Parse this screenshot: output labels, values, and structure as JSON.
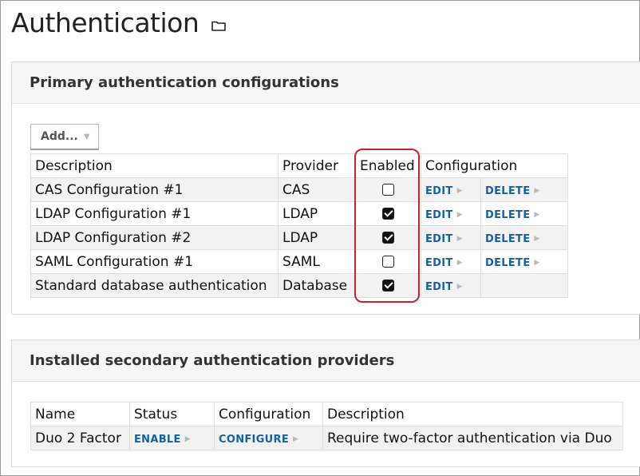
{
  "page": {
    "title": "Authentication",
    "title_icon": "folder-icon"
  },
  "primary": {
    "heading": "Primary authentication configurations",
    "add_label": "Add...",
    "columns": [
      "Description",
      "Provider",
      "Enabled",
      "Configuration"
    ],
    "rows": [
      {
        "description": "CAS Configuration #1",
        "provider": "CAS",
        "enabled": false,
        "edit": "EDIT",
        "delete": "DELETE"
      },
      {
        "description": "LDAP Configuration #1",
        "provider": "LDAP",
        "enabled": true,
        "edit": "EDIT",
        "delete": "DELETE"
      },
      {
        "description": "LDAP Configuration #2",
        "provider": "LDAP",
        "enabled": true,
        "edit": "EDIT",
        "delete": "DELETE"
      },
      {
        "description": "SAML Configuration #1",
        "provider": "SAML",
        "enabled": false,
        "edit": "EDIT",
        "delete": "DELETE"
      },
      {
        "description": "Standard database authentication",
        "provider": "Database",
        "enabled": true,
        "edit": "EDIT",
        "delete": ""
      }
    ]
  },
  "secondary": {
    "heading": "Installed secondary authentication providers",
    "columns": [
      "Name",
      "Status",
      "Configuration",
      "Description"
    ],
    "rows": [
      {
        "name": "Duo 2 Factor",
        "status": "ENABLE",
        "configure": "CONFIGURE",
        "description": "Require two-factor authentication via Duo"
      }
    ]
  },
  "colors": {
    "link": "#17619f",
    "highlight": "#c8232c",
    "header_bg": "#f6f6f6"
  }
}
